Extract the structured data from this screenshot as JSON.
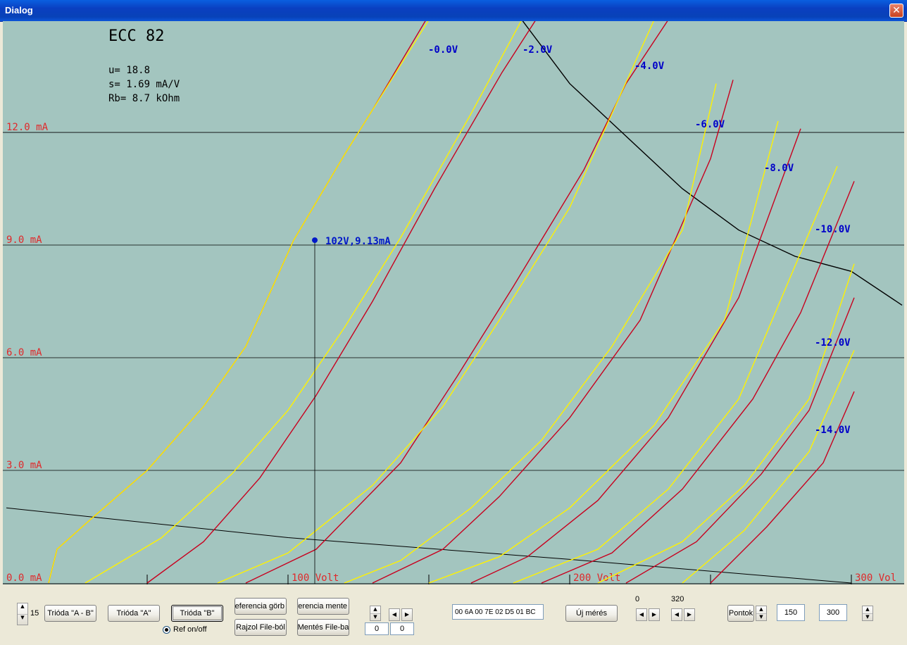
{
  "window": {
    "title": "Dialog",
    "close_glyph": "✕"
  },
  "plot": {
    "tube": "ECC 82",
    "params": [
      "u= 18.8",
      "s= 1.69 mA/V",
      "Rb= 8.7 kOhm"
    ],
    "y_labels": [
      {
        "text": "12.0 mA",
        "value": 12.0
      },
      {
        "text": "9.0 mA",
        "value": 9.0
      },
      {
        "text": "6.0 mA",
        "value": 6.0
      },
      {
        "text": "3.0 mA",
        "value": 3.0
      },
      {
        "text": "0.0 mA",
        "value": 0.0
      }
    ],
    "x_labels": [
      {
        "text": "100 Volt",
        "value": 100
      },
      {
        "text": "200 Volt",
        "value": 200
      },
      {
        "text": "300 Vol",
        "value": 300
      }
    ],
    "marker_label": "102V,9.13mA",
    "marker": {
      "voltage": 102,
      "current": 9.13
    },
    "colors": {
      "background": "#A3C5BF",
      "axis_text": "#E0282A",
      "grid_bias": "#0000C8",
      "curve_a": "#FFF200",
      "curve_b": "#C8001E",
      "marker": "#0018C8"
    }
  },
  "chart_data": {
    "type": "line",
    "title": "ECC 82",
    "xlabel": "Volt",
    "ylabel": "mA",
    "xlim": [
      0,
      317
    ],
    "ylim": [
      0,
      15
    ],
    "grid_lines_y": [
      3,
      6,
      9,
      12
    ],
    "ticks_x": [
      50,
      100,
      150,
      200,
      250,
      300
    ],
    "bias_labels": [
      "-0.0V",
      "-2.0V",
      "-4.0V",
      "-6.0V",
      "-8.0V",
      "-10.0V",
      "-12.0V",
      "-14.0V"
    ],
    "curves_yellow": [
      {
        "bias": "-0.0V",
        "points": [
          [
            15,
            0
          ],
          [
            18,
            0.9
          ],
          [
            30,
            1.7
          ],
          [
            50,
            3.0
          ],
          [
            70,
            4.7
          ],
          [
            85,
            6.3
          ],
          [
            102,
            9.13
          ],
          [
            120,
            11.4
          ],
          [
            130,
            12.6
          ],
          [
            150,
            15.0
          ]
        ]
      },
      {
        "bias": "-2.0V",
        "points": [
          [
            28,
            0
          ],
          [
            55,
            1.2
          ],
          [
            80,
            2.9
          ],
          [
            100,
            4.6
          ],
          [
            120,
            6.8
          ],
          [
            140,
            9.2
          ],
          [
            165,
            12.5
          ],
          [
            183,
            15.0
          ]
        ]
      },
      {
        "bias": "-4.0V",
        "points": [
          [
            75,
            0
          ],
          [
            100,
            0.8
          ],
          [
            130,
            2.6
          ],
          [
            155,
            4.7
          ],
          [
            175,
            7.0
          ],
          [
            200,
            10.0
          ],
          [
            230,
            15.0
          ]
        ]
      },
      {
        "bias": "-6.0V",
        "points": [
          [
            120,
            0
          ],
          [
            140,
            0.6
          ],
          [
            165,
            2.0
          ],
          [
            190,
            3.8
          ],
          [
            215,
            6.3
          ],
          [
            240,
            9.4
          ],
          [
            252,
            13.3
          ]
        ]
      },
      {
        "bias": "-8.0V",
        "points": [
          [
            150,
            0
          ],
          [
            175,
            0.7
          ],
          [
            200,
            2.0
          ],
          [
            230,
            4.2
          ],
          [
            255,
            7.0
          ],
          [
            274,
            12.3
          ]
        ]
      },
      {
        "bias": "-10.0V",
        "points": [
          [
            180,
            0
          ],
          [
            210,
            0.9
          ],
          [
            235,
            2.5
          ],
          [
            260,
            4.9
          ],
          [
            295,
            11.1
          ]
        ]
      },
      {
        "bias": "-12.0V",
        "points": [
          [
            210,
            0
          ],
          [
            240,
            1.1
          ],
          [
            262,
            2.6
          ],
          [
            285,
            4.9
          ],
          [
            301,
            8.5
          ]
        ]
      },
      {
        "bias": "-14.0V",
        "points": [
          [
            240,
            0
          ],
          [
            262,
            1.4
          ],
          [
            285,
            3.5
          ],
          [
            301,
            6.2
          ]
        ]
      }
    ],
    "curves_red": [
      {
        "bias": "-0.0V",
        "points": [
          [
            15,
            0
          ],
          [
            18,
            0.9
          ],
          [
            30,
            1.7
          ],
          [
            50,
            3.0
          ],
          [
            70,
            4.7
          ],
          [
            85,
            6.3
          ],
          [
            102,
            9.13
          ],
          [
            120,
            11.4
          ],
          [
            130,
            12.6
          ],
          [
            149,
            15.0
          ]
        ]
      },
      {
        "bias": "-2.0V",
        "points": [
          [
            50,
            0
          ],
          [
            70,
            1.1
          ],
          [
            90,
            2.8
          ],
          [
            110,
            5.0
          ],
          [
            130,
            7.5
          ],
          [
            152,
            10.5
          ],
          [
            176,
            13.6
          ],
          [
            188,
            15.0
          ]
        ]
      },
      {
        "bias": "-4.0V",
        "points": [
          [
            85,
            0
          ],
          [
            110,
            0.9
          ],
          [
            140,
            3.2
          ],
          [
            160,
            5.5
          ],
          [
            180,
            7.9
          ],
          [
            205,
            11.0
          ],
          [
            220,
            13.3
          ],
          [
            235,
            15.0
          ]
        ]
      },
      {
        "bias": "-6.0V",
        "points": [
          [
            130,
            0
          ],
          [
            155,
            0.9
          ],
          [
            175,
            2.3
          ],
          [
            200,
            4.4
          ],
          [
            225,
            7.0
          ],
          [
            250,
            11.3
          ],
          [
            258,
            13.4
          ]
        ]
      },
      {
        "bias": "-8.0V",
        "points": [
          [
            165,
            0
          ],
          [
            185,
            0.7
          ],
          [
            210,
            2.2
          ],
          [
            235,
            4.4
          ],
          [
            260,
            7.6
          ],
          [
            282,
            12.1
          ]
        ]
      },
      {
        "bias": "-10.0V",
        "points": [
          [
            190,
            0
          ],
          [
            215,
            0.8
          ],
          [
            240,
            2.5
          ],
          [
            265,
            4.9
          ],
          [
            282,
            7.2
          ],
          [
            301,
            10.7
          ]
        ]
      },
      {
        "bias": "-12.0V",
        "points": [
          [
            220,
            0
          ],
          [
            245,
            1.1
          ],
          [
            268,
            2.9
          ],
          [
            285,
            4.6
          ],
          [
            301,
            7.6
          ]
        ]
      },
      {
        "bias": "-14.0V",
        "points": [
          [
            250,
            0
          ],
          [
            270,
            1.5
          ],
          [
            290,
            3.2
          ],
          [
            301,
            5.1
          ]
        ]
      }
    ],
    "load_line": {
      "points": [
        [
          0,
          2.0
        ],
        [
          100,
          1.21
        ],
        [
          200,
          0.63
        ],
        [
          300,
          0.0
        ]
      ]
    },
    "dissipation_curve": {
      "points": [
        [
          183,
          15.0
        ],
        [
          200,
          13.3
        ],
        [
          220,
          11.9
        ],
        [
          240,
          10.5
        ],
        [
          260,
          9.4
        ],
        [
          280,
          8.7
        ],
        [
          300,
          8.3
        ],
        [
          318,
          7.4
        ]
      ]
    }
  },
  "controls": {
    "spin_value": "15",
    "trioda_ab": "Trióda \"A - B\"",
    "trioda_a": "Trióda  \"A\"",
    "trioda_b": "Trióda  \"B\"",
    "ref_curve": "eferencia görb",
    "ref_save": "eferencia mente",
    "draw_file": "Rajzol File-ból",
    "save_file": "Mentés File-ba",
    "ref_toggle": "Ref on/off",
    "field_a": "0",
    "field_b": "0",
    "hex_value": "00 6A 00 7E 02 D5 01 BC",
    "new_measure": "Új mérés",
    "range_min": "0",
    "range_max": "320",
    "points_label": "Pontok",
    "points_a": "150",
    "points_b": "300"
  }
}
